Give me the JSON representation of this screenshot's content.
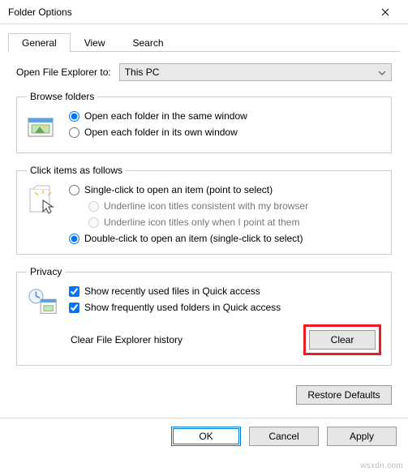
{
  "window": {
    "title": "Folder Options"
  },
  "tabs": {
    "general": "General",
    "view": "View",
    "search": "Search"
  },
  "open_explorer": {
    "label": "Open File Explorer to:",
    "value": "This PC"
  },
  "browse": {
    "legend": "Browse folders",
    "same_window": "Open each folder in the same window",
    "own_window": "Open each folder in its own window"
  },
  "click_items": {
    "legend": "Click items as follows",
    "single": "Single-click to open an item (point to select)",
    "underline_browser": "Underline icon titles consistent with my browser",
    "underline_point": "Underline icon titles only when I point at them",
    "double": "Double-click to open an item (single-click to select)"
  },
  "privacy": {
    "legend": "Privacy",
    "recent_files": "Show recently used files in Quick access",
    "freq_folders": "Show frequently used folders in Quick access",
    "clear_label": "Clear File Explorer history",
    "clear_btn": "Clear"
  },
  "buttons": {
    "restore": "Restore Defaults",
    "ok": "OK",
    "cancel": "Cancel",
    "apply": "Apply"
  },
  "watermark": "wsxdn.com"
}
